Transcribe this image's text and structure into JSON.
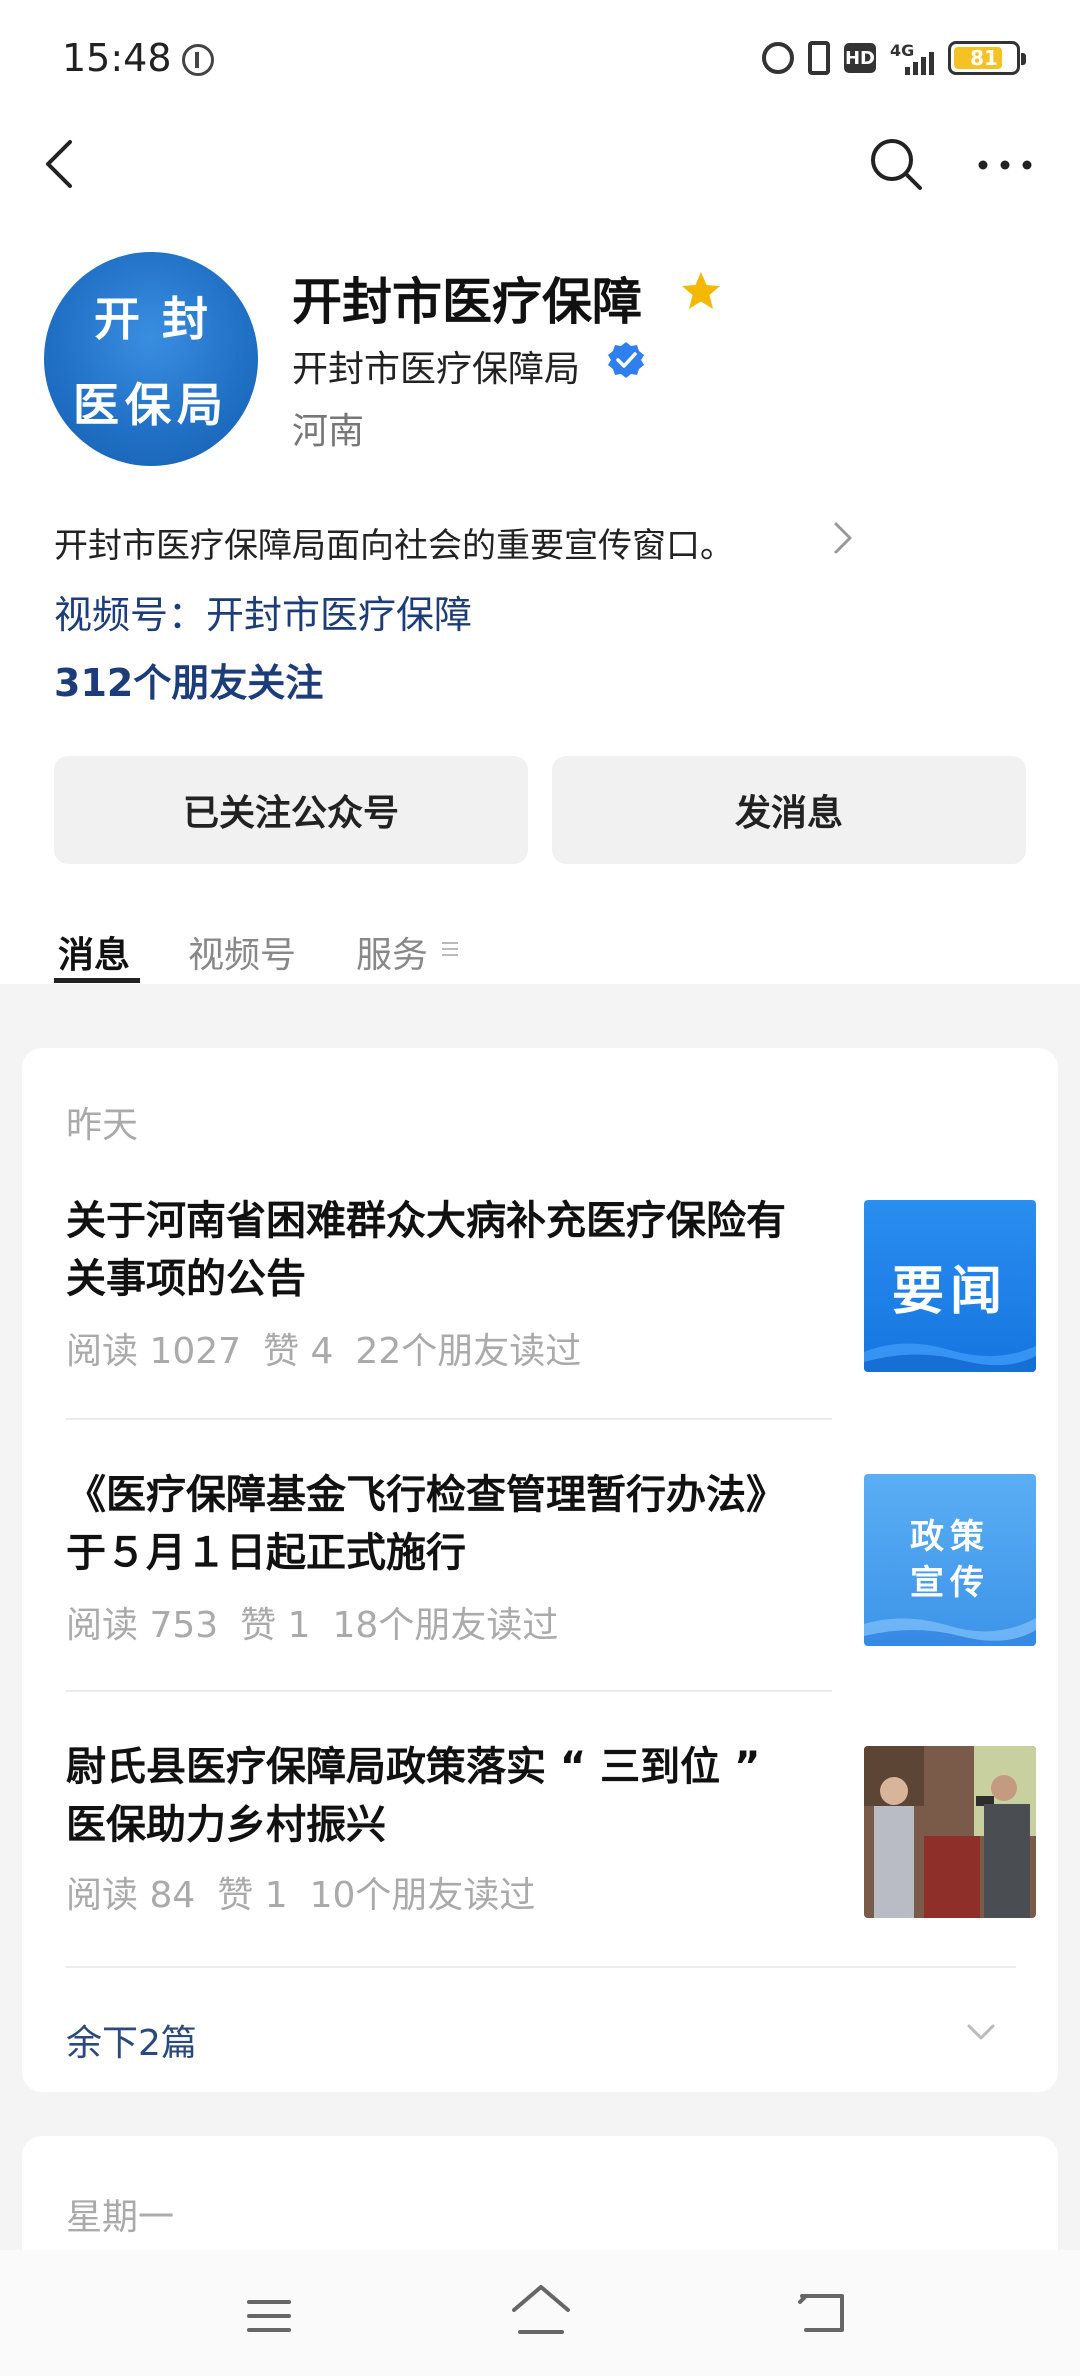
{
  "status": {
    "time": "15:48",
    "battery": "81"
  },
  "profile": {
    "name": "开封市医疗保障",
    "org": "开封市医疗保障局",
    "region": "河南",
    "avatar_line1": "开封",
    "avatar_line2": "医保局",
    "intro": "开封市医疗保障局面向社会的重要宣传窗口。",
    "channel": "视频号：开封市医疗保障",
    "followers": "312个朋友关注"
  },
  "buttons": {
    "follow": "已关注公众号",
    "message": "发消息"
  },
  "tabs": [
    {
      "label": "消息"
    },
    {
      "label": "视频号"
    },
    {
      "label": "服务"
    }
  ],
  "feed": {
    "groups": [
      {
        "date": "昨天",
        "articles": [
          {
            "title": "关于河南省困难群众大病补充医疗保险有关事项的公告",
            "reads": "阅读 1027",
            "likes": "赞 4",
            "friends": "22个朋友读过",
            "thumb_text": "要闻"
          },
          {
            "title": "《医疗保障基金飞行检查管理暂行办法》于５月１日起正式施行",
            "reads": "阅读 753",
            "likes": "赞 1",
            "friends": "18个朋友读过",
            "thumb_line1": "政策",
            "thumb_line2": "宣传"
          },
          {
            "title": "尉氏县医疗保障局政策落实 “ 三到位 ” 医保助力乡村振兴",
            "reads": "阅读 84",
            "likes": "赞 1",
            "friends": "10个朋友读过"
          }
        ],
        "more": "余下2篇"
      },
      {
        "date": "星期一"
      }
    ]
  },
  "colors": {
    "accent_link": "#1d3c7a",
    "star": "#f5b800",
    "verified": "#2f80ed",
    "battery": "#f5c226"
  }
}
